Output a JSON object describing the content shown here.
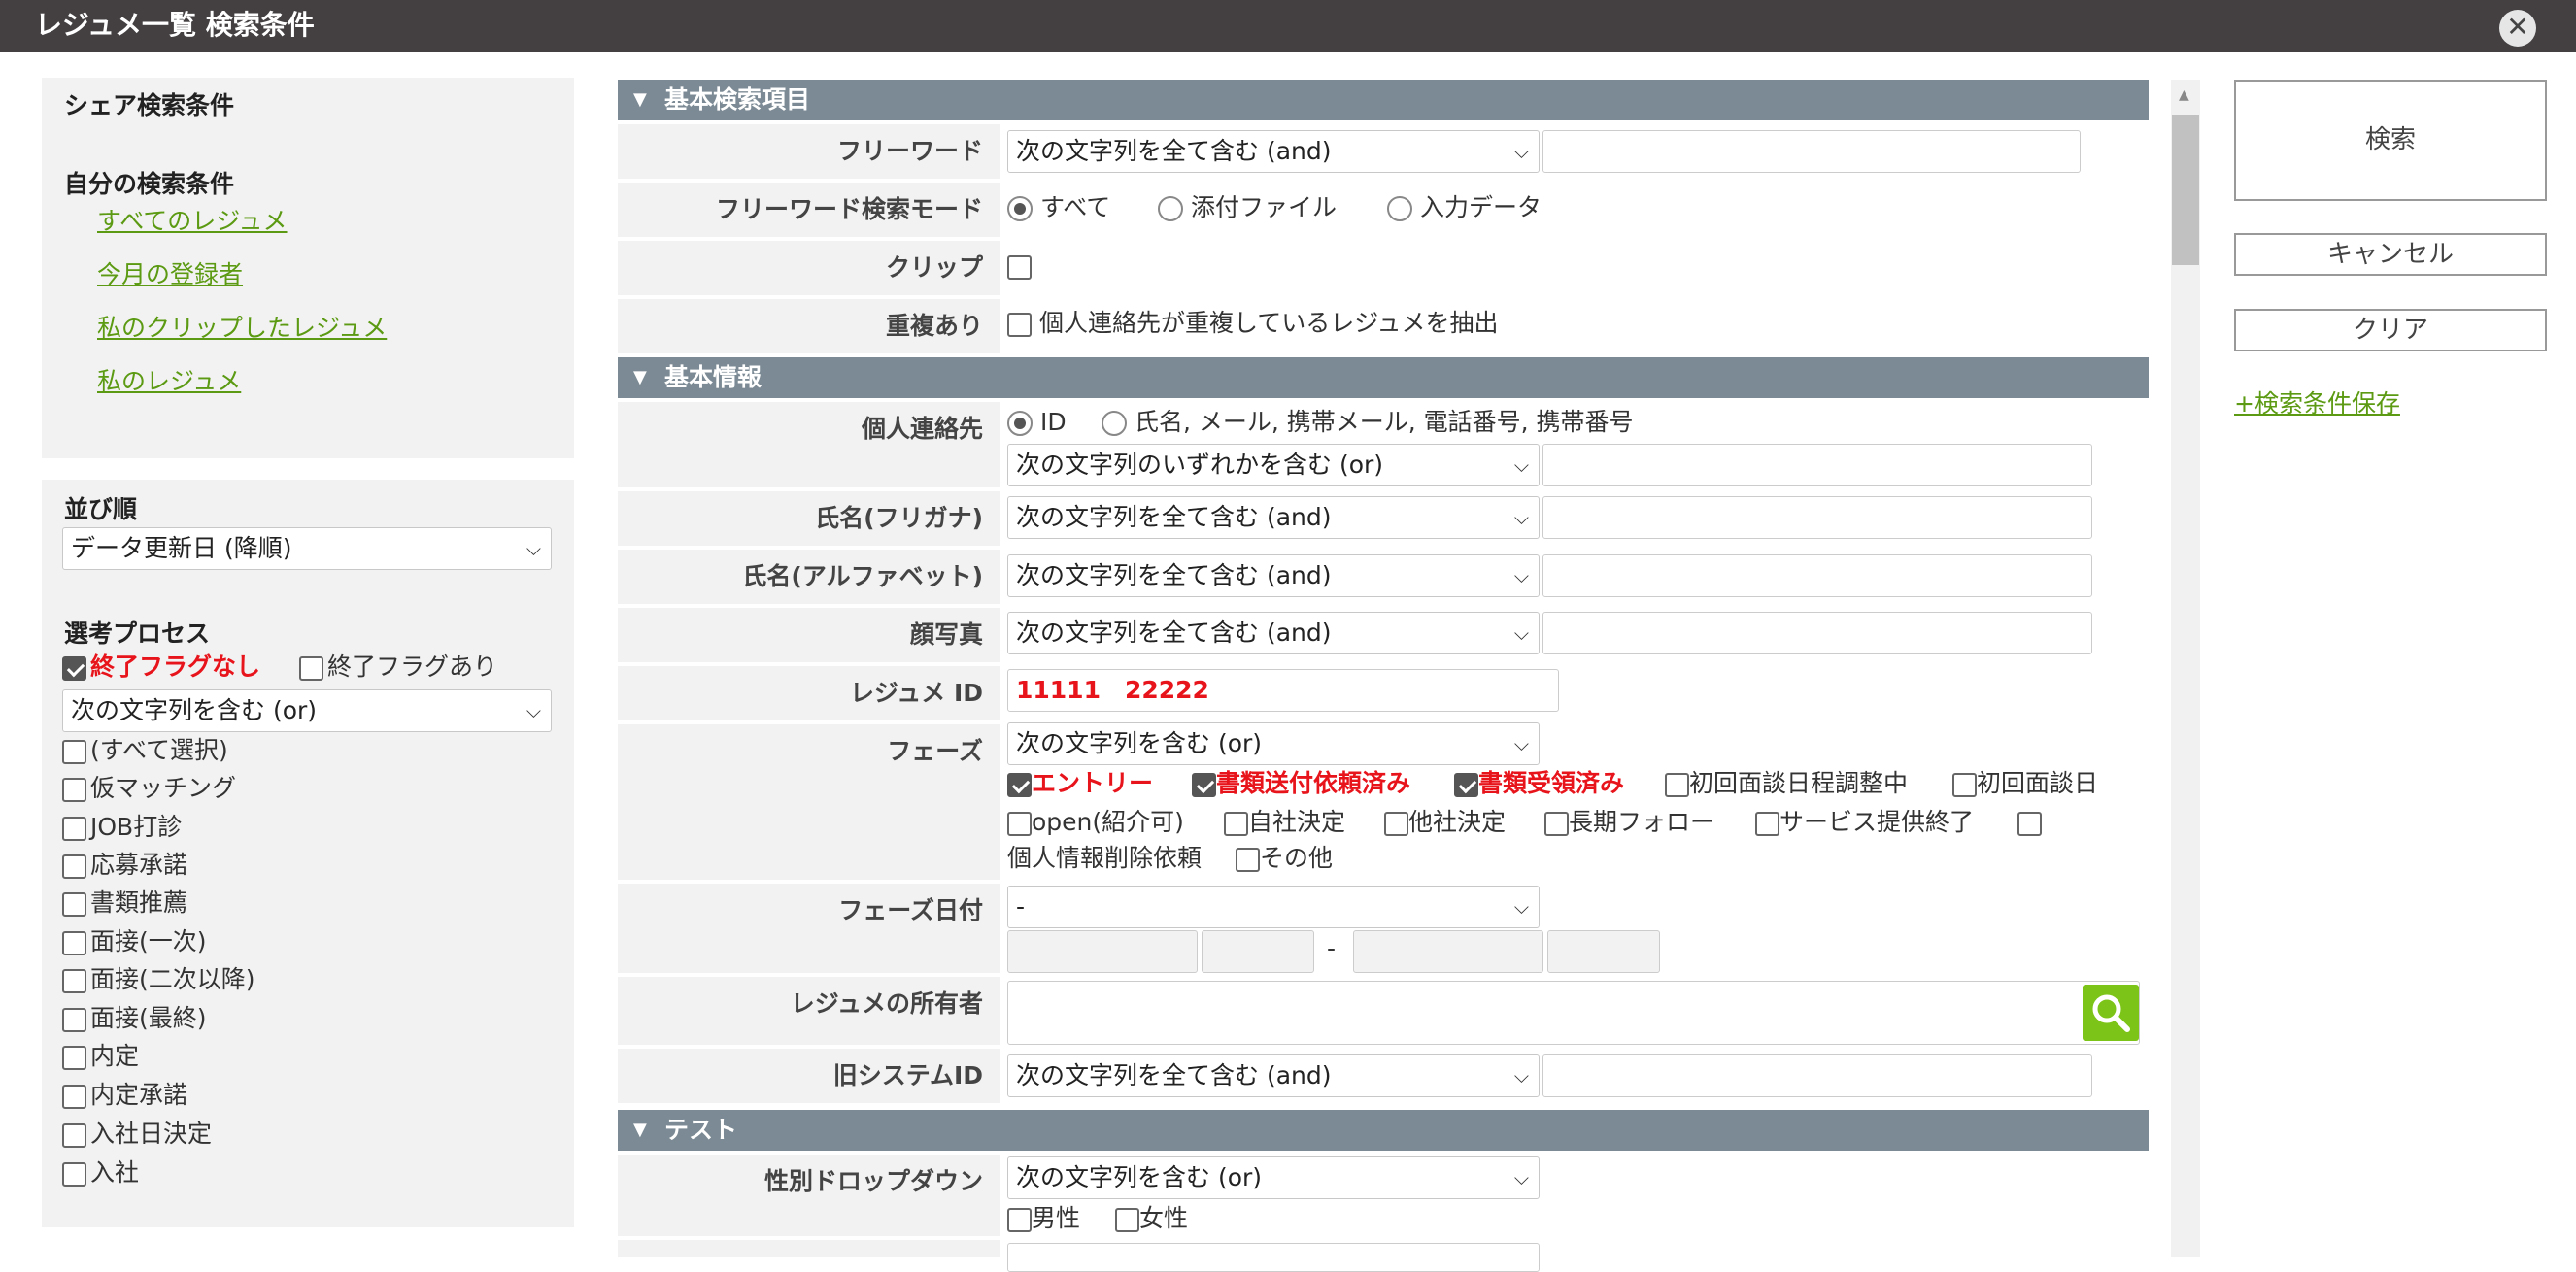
{
  "window": {
    "title": "レジュメ一覧 検索条件",
    "close_icon": "close-icon"
  },
  "left": {
    "share_title": "シェア検索条件",
    "own_title": "自分の検索条件",
    "own_links": [
      "すべてのレジュメ",
      "今月の登録者",
      "私のクリップしたレジュメ",
      "私のレジュメ"
    ],
    "sort_label": "並び順",
    "sort_value": "データ更新日 (降順)",
    "process_label": "選考プロセス",
    "flag_none": "終了フラグなし",
    "flag_exist": "終了フラグあり",
    "process_mode": "次の文字列を含む (or)",
    "process_items": [
      "(すべて選択)",
      "仮マッチング",
      "JOB打診",
      "応募承諾",
      "書類推薦",
      "面接(一次)",
      "面接(二次以降)",
      "面接(最終)",
      "内定",
      "内定承諾",
      "入社日決定",
      "入社"
    ]
  },
  "sections": {
    "basic_search": "基本検索項目",
    "basic_info": "基本情報",
    "test": "テスト"
  },
  "fields": {
    "freeword_label": "フリーワード",
    "freeword_mode": "次の文字列を全て含む (and)",
    "freeword_search_mode_label": "フリーワード検索モード",
    "search_mode_options": [
      "すべて",
      "添付ファイル",
      "入力データ"
    ],
    "clip_label": "クリップ",
    "duplicate_label": "重複あり",
    "duplicate_option": "個人連絡先が重複しているレジュメを抽出",
    "contact_label": "個人連絡先",
    "contact_options": [
      "ID",
      "氏名, メール, 携帯メール, 電話番号, 携帯番号"
    ],
    "contact_mode": "次の文字列のいずれかを含む (or)",
    "name_kana_label": "氏名(フリガナ)",
    "name_kana_mode": "次の文字列を全て含む (and)",
    "name_alpha_label": "氏名(アルファベット)",
    "name_alpha_mode": "次の文字列を全て含む (and)",
    "photo_label": "顔写真",
    "photo_mode": "次の文字列を全て含む (and)",
    "resume_id_label": "レジュメ ID",
    "resume_id_value": "11111　22222",
    "phase_label": "フェーズ",
    "phase_mode": "次の文字列を含む (or)",
    "phase_checked": [
      "エントリー",
      "書類送付依頼済み",
      "書類受領済み"
    ],
    "phase_unchecked_1": [
      "初回面談日程調整中",
      "初回面談日"
    ],
    "phase_unchecked_2": [
      "open(紹介可)",
      "自社決定",
      "他社決定",
      "長期フォロー",
      "サービス提供終了"
    ],
    "phase_unchecked_3_text": "個人情報削除依頼",
    "phase_other": "その他",
    "phase_date_label": "フェーズ日付",
    "phase_date_value": "-",
    "phase_date_sep": "-",
    "owner_label": "レジュメの所有者",
    "old_id_label": "旧システムID",
    "old_id_mode": "次の文字列を全て含む (and)",
    "gender_label": "性別ドロップダウン",
    "gender_mode": "次の文字列を含む (or)",
    "gender_options": [
      "男性",
      "女性"
    ]
  },
  "buttons": {
    "search": "検索",
    "cancel": "キャンセル",
    "clear": "クリア",
    "save_condition": "+検索条件保存"
  },
  "colors": {
    "accent": "#5b9a12",
    "section_bar": "#7b8a94",
    "title_bar": "#444041",
    "red": "#e8141c",
    "search_icon_bg": "#7dc418"
  }
}
